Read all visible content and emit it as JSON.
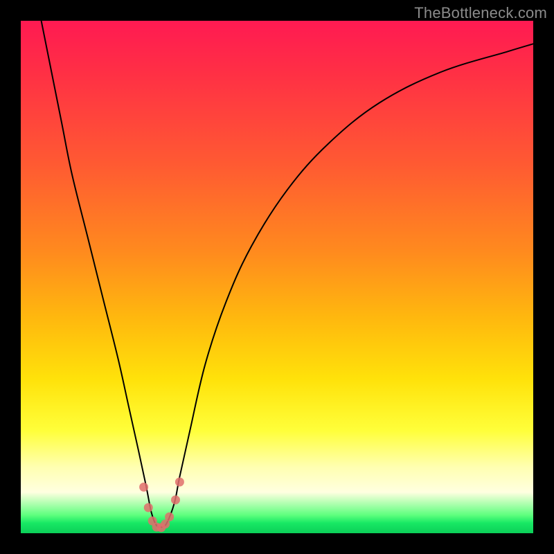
{
  "attribution": "TheBottleneck.com",
  "colors": {
    "background": "#000000",
    "gradient_top": "#ff1a52",
    "gradient_mid": "#ffe20a",
    "gradient_band": "#ffffe0",
    "gradient_bottom": "#0bcf58",
    "curve": "#000000",
    "dots": "#e06f6c"
  },
  "chart_data": {
    "type": "line",
    "title": "",
    "xlabel": "",
    "ylabel": "",
    "xlim": [
      0,
      100
    ],
    "ylim": [
      0,
      100
    ],
    "x_min_at": 27,
    "series": [
      {
        "name": "bottleneck-curve",
        "x": [
          4,
          6,
          8,
          10,
          13,
          16,
          19,
          21,
          23,
          24.5,
          25.5,
          26.5,
          27.5,
          28.5,
          30,
          31,
          33,
          36,
          40,
          45,
          52,
          60,
          70,
          82,
          95,
          100
        ],
        "values": [
          100,
          90,
          80,
          70,
          58,
          46,
          34,
          25,
          16,
          9,
          4,
          1.5,
          1.2,
          2,
          6,
          11,
          20,
          33,
          45,
          56,
          67,
          76,
          84,
          90,
          94,
          95.5
        ]
      }
    ],
    "dots": {
      "name": "highlight-dots",
      "x": [
        24.0,
        24.9,
        25.7,
        26.5,
        27.4,
        28.2,
        29.0,
        30.2,
        31.0
      ],
      "values": [
        9.0,
        5.0,
        2.4,
        1.2,
        1.1,
        1.8,
        3.2,
        6.5,
        10.0
      ]
    }
  }
}
